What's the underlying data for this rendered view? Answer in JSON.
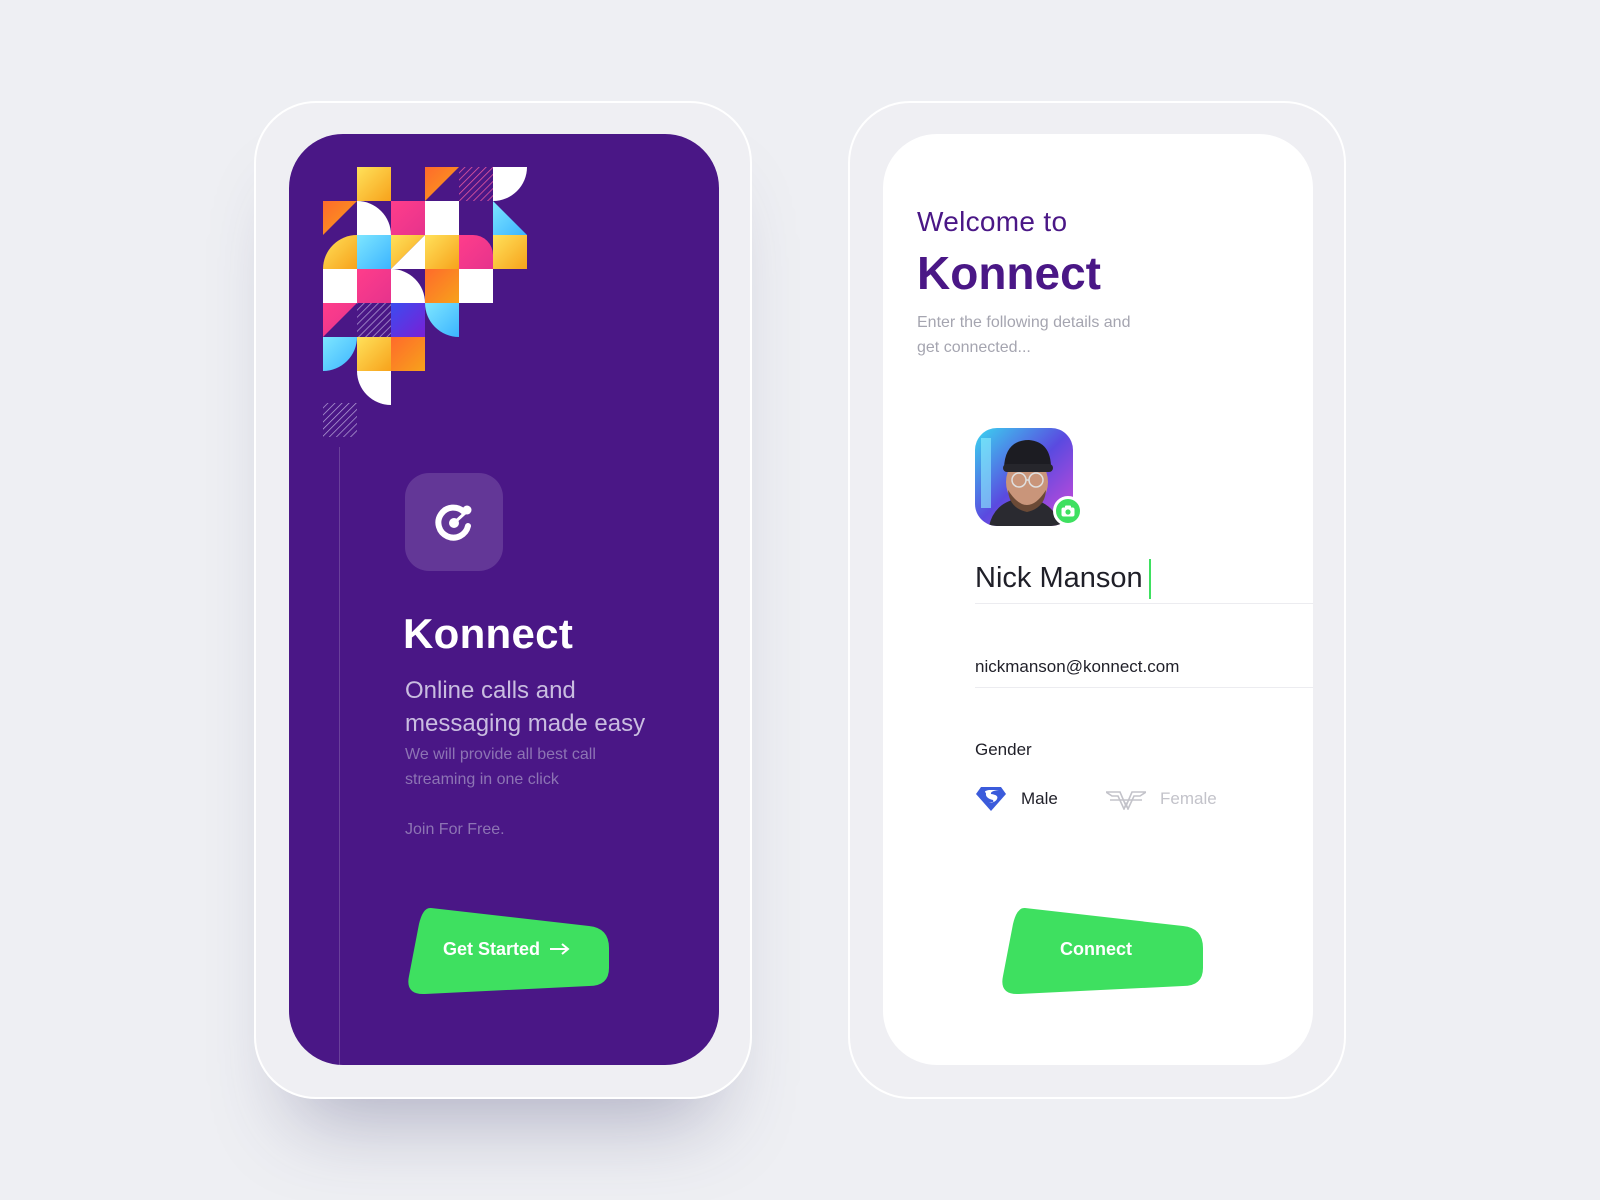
{
  "colors": {
    "background": "#eeeff3",
    "brand_purple": "#4a1786",
    "accent_green": "#3ee060",
    "muted_text": "#a5a5b0"
  },
  "intro_screen": {
    "app_icon": "konnect-logo-icon",
    "title": "Konnect",
    "tagline": "Online calls and messaging made easy",
    "description": "We will provide all best call streaming in one click",
    "join_text": "Join For Free.",
    "cta_label": "Get Started",
    "cta_icon": "arrow-right-icon"
  },
  "signup_screen": {
    "welcome": "Welcome to",
    "title": "Konnect",
    "instructions": "Enter the following details and get connected...",
    "avatar_icon": "profile-photo",
    "camera_icon": "camera-icon",
    "name_value": "Nick Manson",
    "email_value": "nickmanson@konnect.com",
    "gender_label": "Gender",
    "gender_options": [
      {
        "label": "Male",
        "icon": "superman-logo-icon",
        "selected": true
      },
      {
        "label": "Female",
        "icon": "wonder-woman-logo-icon",
        "selected": false
      }
    ],
    "submit_label": "Connect"
  }
}
